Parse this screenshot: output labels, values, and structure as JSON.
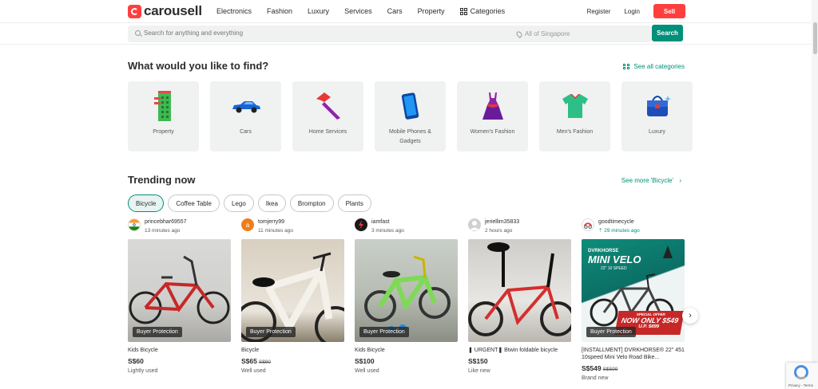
{
  "header": {
    "logo_text": "carousell",
    "nav": [
      "Electronics",
      "Fashion",
      "Luxury",
      "Services",
      "Cars",
      "Property"
    ],
    "categories_label": "Categories",
    "register": "Register",
    "login": "Login",
    "sell": "Sell"
  },
  "search": {
    "placeholder": "Search for anything and everything",
    "location": "All of Singapore",
    "button": "Search"
  },
  "categories_section": {
    "title": "What would you like to find?",
    "see_all": "See all categories",
    "items": [
      {
        "label": "Property",
        "icon": "building-icon"
      },
      {
        "label": "Cars",
        "icon": "car-icon"
      },
      {
        "label": "Home Services",
        "icon": "hammer-icon"
      },
      {
        "label": "Mobile Phones & Gadgets",
        "icon": "phone-icon"
      },
      {
        "label": "Women's Fashion",
        "icon": "dress-icon"
      },
      {
        "label": "Men's Fashion",
        "icon": "shirt-icon"
      },
      {
        "label": "Luxury",
        "icon": "handbag-icon"
      }
    ]
  },
  "trending": {
    "title": "Trending now",
    "see_more": "See more 'Bicycle'",
    "chips": [
      "Bicycle",
      "Coffee Table",
      "Lego",
      "Ikea",
      "Brompton",
      "Plants"
    ],
    "active_chip": "Bicycle",
    "listings": [
      {
        "seller": "princebhar69557",
        "time": "13 minutes ago",
        "badge": "Buyer Protection",
        "title": "Kids Bicycle",
        "price": "S$60",
        "original_price": "",
        "condition": "Lightly used"
      },
      {
        "seller": "tomjerry99",
        "avatar_letter": "a",
        "time": "11 minutes ago",
        "badge": "Buyer Protection",
        "title": "Bicycle",
        "price": "S$65",
        "original_price": "S$90",
        "condition": "Well used"
      },
      {
        "seller": "iamfast",
        "time": "3 minutes ago",
        "badge": "Buyer Protection",
        "title": "Kids Bicycle",
        "price": "S$100",
        "original_price": "",
        "condition": "Well used"
      },
      {
        "seller": "jeriellim35833",
        "time": "2 hours ago",
        "badge": "",
        "title": "❚ URGENT❚ Btwin foldable bicycle",
        "price": "S$150",
        "original_price": "",
        "condition": "Like new"
      },
      {
        "seller": "goodtimecycle",
        "time": "29 minutes ago",
        "badge": "Buyer Protection",
        "title": "[INSTALLMENT] DVRKHORSE® 22\" 451 10speed Mini Velo Road Bike...",
        "price": "S$549",
        "original_price": "S$599",
        "condition": "Brand new"
      }
    ],
    "promo": {
      "brand": "DVRKHORSE",
      "model": "MINI VELO",
      "spec": "22\" 10 SPEED",
      "offer": "SPECIAL OFFER",
      "now_only": "NOW ONLY $549",
      "up": "U.P. $899"
    }
  },
  "recaptcha": {
    "text": "Privacy - Terms"
  },
  "colors": {
    "brand_red": "#ff3e3e",
    "teal": "#008f79"
  }
}
